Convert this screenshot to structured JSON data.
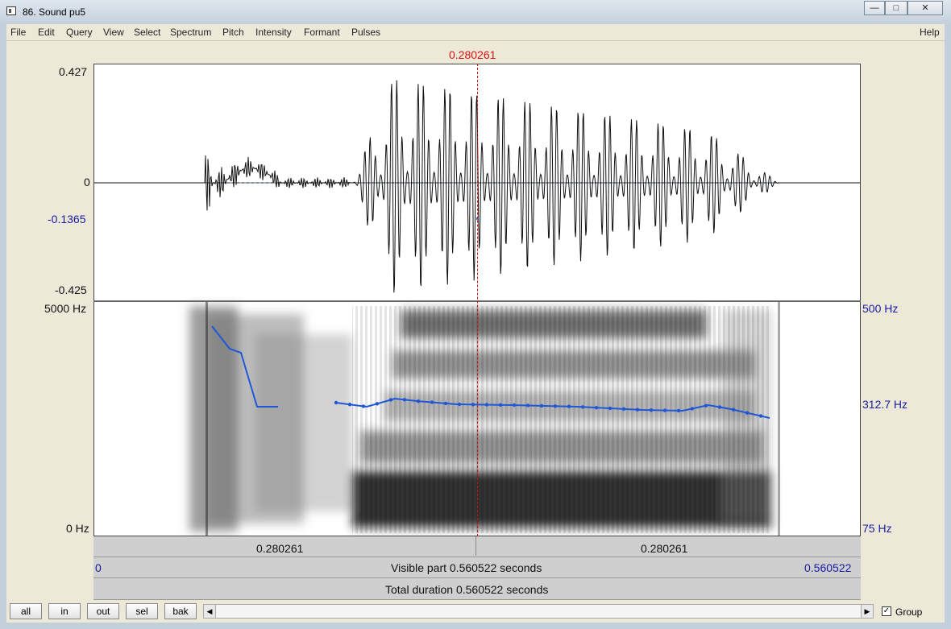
{
  "window": {
    "title": "86. Sound pu5",
    "minimize_icon": "minimize-icon",
    "maximize_icon": "maximize-icon",
    "close_icon": "close-icon"
  },
  "menu": {
    "items": [
      "File",
      "Edit",
      "Query",
      "View",
      "Select",
      "Spectrum",
      "Pitch",
      "Intensity",
      "Formant",
      "Pulses"
    ],
    "help": "Help"
  },
  "cursor": {
    "time_label": "0.280261"
  },
  "waveform": {
    "max_label": "0.427",
    "zero_label": "0",
    "cursor_value_label": "-0.1365",
    "min_label": "-0.425"
  },
  "spectrogram": {
    "freq_top_label": "5000 Hz",
    "freq_bottom_label": "0 Hz"
  },
  "pitch": {
    "top_label": "500 Hz",
    "cursor_label": "312.7 Hz",
    "bottom_label": "75 Hz",
    "color": "#1f57d6"
  },
  "time_bars": {
    "left_segment": "0.280261",
    "right_segment": "0.280261",
    "visible_start": "0",
    "visible_text": "Visible part 0.560522 seconds",
    "visible_end": "0.560522",
    "total_text": "Total duration 0.560522 seconds"
  },
  "bottom": {
    "buttons": [
      "all",
      "in",
      "out",
      "sel",
      "bak"
    ],
    "group_label": "Group",
    "group_checked": true
  }
}
